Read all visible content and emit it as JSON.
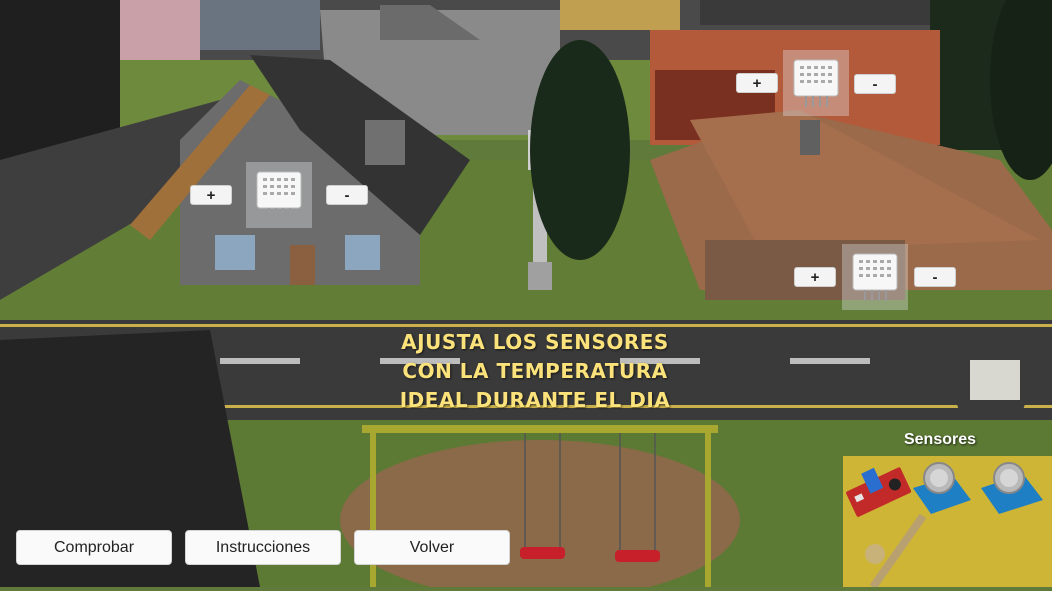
{
  "sensors": [
    {
      "plus": "+",
      "minus": "-"
    },
    {
      "plus": "+",
      "minus": "-"
    },
    {
      "plus": "+",
      "minus": "-"
    }
  ],
  "instruction_lines": [
    "AJUSTA LOS SENSORES",
    "CON LA TEMPERATURA",
    "IDEAL DURANTE EL DIA"
  ],
  "buttons": {
    "check": "Comprobar",
    "instructions": "Instrucciones",
    "back": "Volver"
  },
  "sensor_panel": {
    "title": "Sensores",
    "items": [
      "sound-sensor-module-icon",
      "gas-sensor-module-icon",
      "gas-sensor-module-icon"
    ]
  },
  "colors": {
    "title_text": "#fbe27a",
    "panel": "#ecc436",
    "sensor_body": "#ffffff",
    "module_board": "#1f7fc4"
  }
}
